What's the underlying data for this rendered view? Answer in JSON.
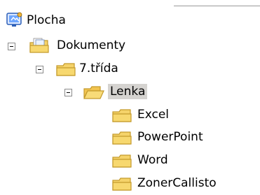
{
  "tree": {
    "nodes": [
      {
        "label": "Plocha",
        "icon": "desktop-icon"
      },
      {
        "label": "Dokumenty",
        "icon": "documents-folder-icon",
        "expanded": true
      },
      {
        "label": "7.třída",
        "icon": "folder-icon",
        "expanded": true
      },
      {
        "label": "Lenka",
        "icon": "open-folder-icon",
        "expanded": true,
        "selected": true
      },
      {
        "label": "Excel",
        "icon": "folder-icon"
      },
      {
        "label": "PowerPoint",
        "icon": "folder-icon"
      },
      {
        "label": "Word",
        "icon": "folder-icon"
      },
      {
        "label": "ZonerCallisto",
        "icon": "folder-icon"
      }
    ]
  },
  "colors": {
    "selection_background": "#d5d3d0",
    "folder_yellow": "#f5d36a",
    "folder_outline": "#c49a2c"
  }
}
